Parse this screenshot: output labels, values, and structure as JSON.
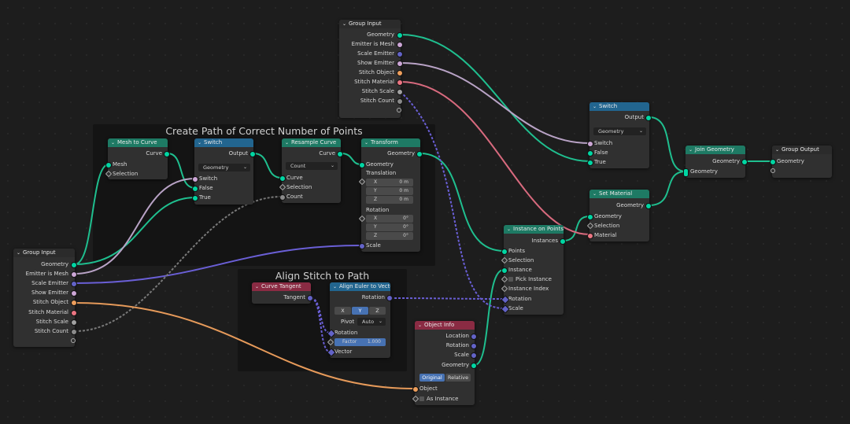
{
  "frames": {
    "create_path": "Create Path of Correct Number of Points",
    "align_stitch": "Align Stitch to Path"
  },
  "nodes": {
    "group_input_top": {
      "title": "Group Input",
      "outputs": [
        "Geometry",
        "Emitter is Mesh",
        "Scale Emitter",
        "Show Emitter",
        "Stitch Object",
        "Stitch Material",
        "Stitch Scale",
        "Stitch Count"
      ]
    },
    "group_input_left": {
      "title": "Group Input",
      "outputs": [
        "Geometry",
        "Emitter is Mesh",
        "Scale Emitter",
        "Show Emitter",
        "Stitch Object",
        "Stitch Material",
        "Stitch Scale",
        "Stitch Count"
      ]
    },
    "mesh_to_curve": {
      "title": "Mesh to Curve",
      "output": "Curve",
      "inputs": [
        "Mesh",
        "Selection"
      ]
    },
    "switch_left": {
      "title": "Switch",
      "output": "Output",
      "mode": "Geometry",
      "inputs": [
        "Switch",
        "False",
        "True"
      ]
    },
    "resample_curve": {
      "title": "Resample Curve",
      "output": "Curve",
      "mode": "Count",
      "inputs": [
        "Curve",
        "Selection",
        "Count"
      ]
    },
    "transform": {
      "title": "Transform",
      "output": "Geometry",
      "input": "Geometry",
      "translation_label": "Translation",
      "translation": [
        {
          "axis": "X",
          "value": "0 m"
        },
        {
          "axis": "Y",
          "value": "0 m"
        },
        {
          "axis": "Z",
          "value": "0 m"
        }
      ],
      "rotation_label": "Rotation",
      "rotation": [
        {
          "axis": "X",
          "value": "0°"
        },
        {
          "axis": "Y",
          "value": "0°"
        },
        {
          "axis": "Z",
          "value": "0°"
        }
      ],
      "scale_label": "Scale"
    },
    "curve_tangent": {
      "title": "Curve Tangent",
      "output": "Tangent"
    },
    "align_euler": {
      "title": "Align Euler to Vector",
      "output": "Rotation",
      "axes": [
        "X",
        "Y",
        "Z"
      ],
      "active_axis": "Y",
      "pivot_label": "Pivot",
      "pivot_value": "Auto",
      "rotation_in": "Rotation",
      "factor_label": "Factor",
      "factor_value": "1.000",
      "vector_in": "Vector"
    },
    "object_info": {
      "title": "Object Info",
      "outputs": [
        "Location",
        "Rotation",
        "Scale",
        "Geometry"
      ],
      "modes": [
        "Original",
        "Relative"
      ],
      "active_mode": "Original",
      "object_in": "Object",
      "as_instance": "As Instance"
    },
    "instance_on_points": {
      "title": "Instance on Points",
      "output": "Instances",
      "inputs": [
        "Points",
        "Selection",
        "Instance",
        "Pick Instance",
        "Instance Index",
        "Rotation",
        "Scale"
      ]
    },
    "switch_right": {
      "title": "Switch",
      "output": "Output",
      "mode": "Geometry",
      "inputs": [
        "Switch",
        "False",
        "True"
      ]
    },
    "set_material": {
      "title": "Set Material",
      "output": "Geometry",
      "inputs": [
        "Geometry",
        "Selection",
        "Material"
      ]
    },
    "join_geometry": {
      "title": "Join Geometry",
      "output": "Geometry",
      "input": "Geometry"
    },
    "group_output": {
      "title": "Group Output",
      "input": "Geometry"
    }
  },
  "colors": {
    "geometry": "#00d6a3",
    "bool": "#cca6d6",
    "float": "#a1a1a1",
    "int": "#598c5c",
    "vector": "#6363c7",
    "object": "#ed9e5c",
    "material": "#eb7582",
    "background": "#1d1d1d",
    "frame": "#141414"
  }
}
